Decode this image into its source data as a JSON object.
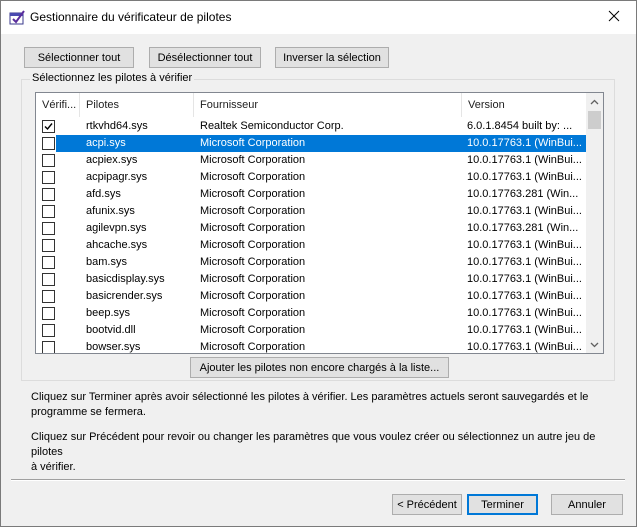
{
  "window": {
    "title": "Gestionnaire du vérificateur de pilotes"
  },
  "toolbar": {
    "select_all": "Sélectionner tout",
    "deselect_all": "Désélectionner tout",
    "invert_selection": "Inverser la sélection"
  },
  "group": {
    "label": "Sélectionnez les pilotes à vérifier"
  },
  "list": {
    "columns": [
      "Vérifi...",
      "Pilotes",
      "Fournisseur",
      "Version"
    ],
    "rows": [
      {
        "checked": true,
        "selected": false,
        "driver": "rtkvhd64.sys",
        "vendor": "Realtek Semiconductor Corp.",
        "version": "6.0.1.8454 built by: ..."
      },
      {
        "checked": false,
        "selected": true,
        "driver": "acpi.sys",
        "vendor": "Microsoft Corporation",
        "version": "10.0.17763.1 (WinBui..."
      },
      {
        "checked": false,
        "selected": false,
        "driver": "acpiex.sys",
        "vendor": "Microsoft Corporation",
        "version": "10.0.17763.1 (WinBui..."
      },
      {
        "checked": false,
        "selected": false,
        "driver": "acpipagr.sys",
        "vendor": "Microsoft Corporation",
        "version": "10.0.17763.1 (WinBui..."
      },
      {
        "checked": false,
        "selected": false,
        "driver": "afd.sys",
        "vendor": "Microsoft Corporation",
        "version": "10.0.17763.281 (Win..."
      },
      {
        "checked": false,
        "selected": false,
        "driver": "afunix.sys",
        "vendor": "Microsoft Corporation",
        "version": "10.0.17763.1 (WinBui..."
      },
      {
        "checked": false,
        "selected": false,
        "driver": "agilevpn.sys",
        "vendor": "Microsoft Corporation",
        "version": "10.0.17763.281 (Win..."
      },
      {
        "checked": false,
        "selected": false,
        "driver": "ahcache.sys",
        "vendor": "Microsoft Corporation",
        "version": "10.0.17763.1 (WinBui..."
      },
      {
        "checked": false,
        "selected": false,
        "driver": "bam.sys",
        "vendor": "Microsoft Corporation",
        "version": "10.0.17763.1 (WinBui..."
      },
      {
        "checked": false,
        "selected": false,
        "driver": "basicdisplay.sys",
        "vendor": "Microsoft Corporation",
        "version": "10.0.17763.1 (WinBui..."
      },
      {
        "checked": false,
        "selected": false,
        "driver": "basicrender.sys",
        "vendor": "Microsoft Corporation",
        "version": "10.0.17763.1 (WinBui..."
      },
      {
        "checked": false,
        "selected": false,
        "driver": "beep.sys",
        "vendor": "Microsoft Corporation",
        "version": "10.0.17763.1 (WinBui..."
      },
      {
        "checked": false,
        "selected": false,
        "driver": "bootvid.dll",
        "vendor": "Microsoft Corporation",
        "version": "10.0.17763.1 (WinBui..."
      },
      {
        "checked": false,
        "selected": false,
        "driver": "bowser.sys",
        "vendor": "Microsoft Corporation",
        "version": "10.0.17763.1 (WinBui..."
      }
    ]
  },
  "add_drivers_label": "Ajouter les pilotes non encore chargés à la liste...",
  "info": {
    "line1": "Cliquez sur Terminer après avoir sélectionné les pilotes à vérifier. Les paramètres actuels seront sauvegardés et le",
    "line2": "programme se fermera.",
    "line3": "Cliquez sur Précédent pour revoir ou changer les paramètres que vous voulez créer ou sélectionnez un autre jeu de pilotes",
    "line4": "à vérifier."
  },
  "footer": {
    "back_label": "< Précédent",
    "finish_label": "Terminer",
    "cancel_label": "Annuler"
  },
  "icons": {
    "app": "driver-verifier-icon",
    "close": "close-icon",
    "check": "checkmark-icon",
    "scroll_up": "chevron-up-icon",
    "scroll_down": "chevron-down-icon"
  },
  "colors": {
    "selection": "#0078d7",
    "window_bg": "#f0f0f0",
    "button_bg": "#e1e1e1"
  }
}
